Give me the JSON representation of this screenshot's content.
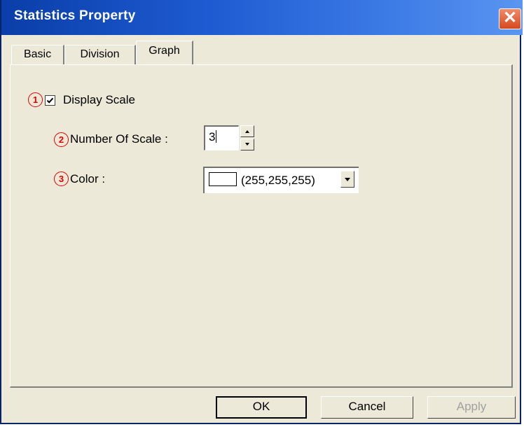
{
  "window": {
    "title": "Statistics Property",
    "close_glyph": "✕"
  },
  "tabs": [
    {
      "label": "Basic",
      "active": false
    },
    {
      "label": "Division",
      "active": false
    },
    {
      "label": "Graph",
      "active": true
    }
  ],
  "markers": [
    "1",
    "2",
    "3"
  ],
  "display_scale": {
    "label": "Display Scale",
    "checked": true
  },
  "number_of_scale": {
    "label": "Number Of Scale :",
    "value": "3"
  },
  "color": {
    "label": "Color :",
    "value": "(255,255,255)",
    "swatch": "#ffffff"
  },
  "buttons": {
    "ok": "OK",
    "cancel": "Cancel",
    "apply": "Apply"
  }
}
